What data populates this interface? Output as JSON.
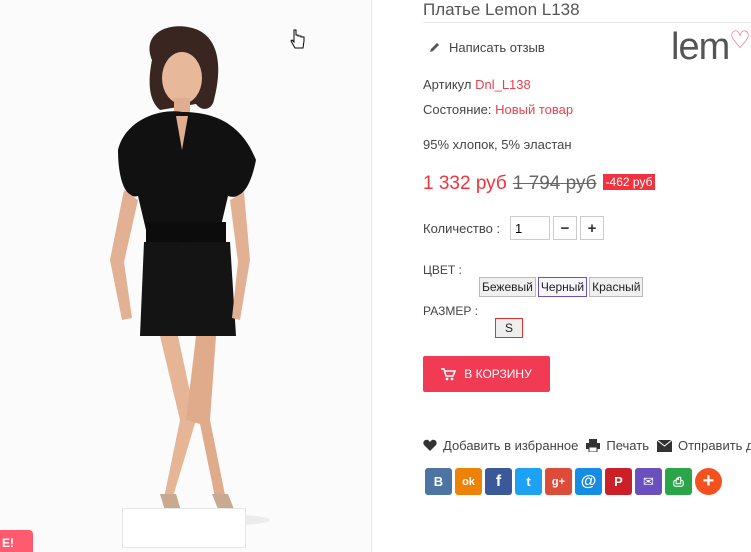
{
  "product": {
    "title": "Платье Lemon L138",
    "review_label": "Написать отзыв",
    "brand_logo": "lem",
    "sku_label": "Артикул",
    "sku_value": "Dnl_L138",
    "condition_label": "Состояние:",
    "condition_value": "Новый товар",
    "composition": "95% хлопок, 5% эластан",
    "price_new": "1 332 руб",
    "price_old": "1 794 руб",
    "discount": "-462 руб",
    "quantity_label": "Количество :",
    "quantity_value": "1",
    "qty_minus": "−",
    "qty_plus": "+",
    "color_label": "ЦВЕТ :",
    "colors": [
      "Бежевый",
      "Черный",
      "Красный"
    ],
    "selected_color": "Черный",
    "size_label": "РАЗМЕР :",
    "sizes": [
      "S"
    ],
    "cart_button": "В КОРЗИНУ"
  },
  "actions": {
    "wishlist": "Добавить в избранное",
    "print": "Печать",
    "send": "Отправить д"
  },
  "share": [
    {
      "name": "vk-icon",
      "glyph": "B",
      "color": "#4c75a3"
    },
    {
      "name": "odnoklassniki-icon",
      "glyph": "ok",
      "color": "#ee8208"
    },
    {
      "name": "facebook-icon",
      "glyph": "f",
      "color": "#3b5998"
    },
    {
      "name": "twitter-icon",
      "glyph": "t",
      "color": "#1da1f2"
    },
    {
      "name": "googleplus-icon",
      "glyph": "g+",
      "color": "#dd4b39"
    },
    {
      "name": "mailru-icon",
      "glyph": "@",
      "color": "#168de2"
    },
    {
      "name": "pinterest-icon",
      "glyph": "P",
      "color": "#cb2027"
    },
    {
      "name": "email-icon",
      "glyph": "✉",
      "color": "#6a4fbf"
    },
    {
      "name": "print-icon",
      "glyph": "⎙",
      "color": "#2aa54a"
    },
    {
      "name": "more-icon",
      "glyph": "+",
      "color": "#f4511e"
    }
  ],
  "image": {
    "corner_badge": "E!"
  }
}
